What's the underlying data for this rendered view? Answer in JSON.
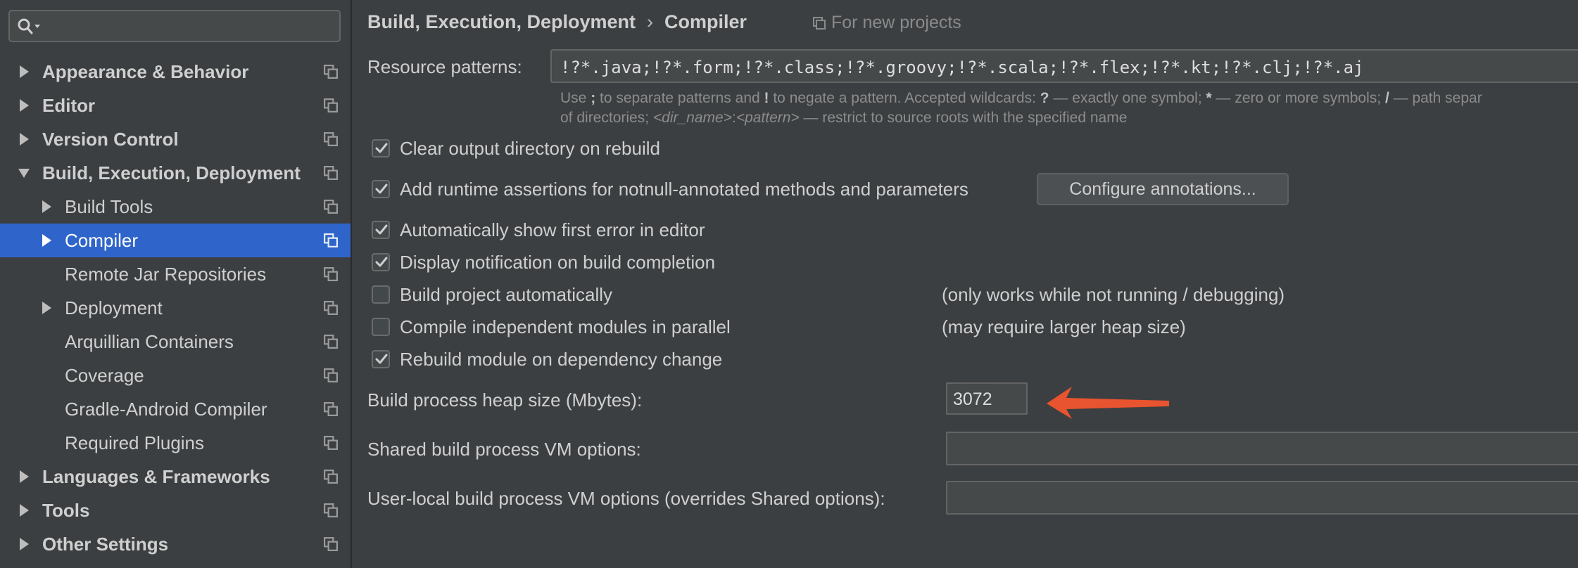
{
  "colors": {
    "selection": "#2f65ca",
    "background": "#3c3f41",
    "arrow_annotation": "#e8542f"
  },
  "sidebar": {
    "search": {
      "value": "",
      "icon": "search-icon"
    },
    "items": [
      {
        "label": "Appearance & Behavior",
        "expandable": true,
        "expanded": false,
        "level": 0
      },
      {
        "label": "Editor",
        "expandable": true,
        "expanded": false,
        "level": 0
      },
      {
        "label": "Version Control",
        "expandable": true,
        "expanded": false,
        "level": 0
      },
      {
        "label": "Build, Execution, Deployment",
        "expandable": true,
        "expanded": true,
        "level": 0
      },
      {
        "label": "Build Tools",
        "expandable": true,
        "expanded": false,
        "level": 1
      },
      {
        "label": "Compiler",
        "expandable": true,
        "expanded": false,
        "level": 1,
        "selected": true
      },
      {
        "label": "Remote Jar Repositories",
        "expandable": false,
        "level": 1
      },
      {
        "label": "Deployment",
        "expandable": true,
        "expanded": false,
        "level": 1
      },
      {
        "label": "Arquillian Containers",
        "expandable": false,
        "level": 1
      },
      {
        "label": "Coverage",
        "expandable": false,
        "level": 1
      },
      {
        "label": "Gradle-Android Compiler",
        "expandable": false,
        "level": 1
      },
      {
        "label": "Required Plugins",
        "expandable": false,
        "level": 1
      },
      {
        "label": "Languages & Frameworks",
        "expandable": true,
        "expanded": false,
        "level": 0
      },
      {
        "label": "Tools",
        "expandable": true,
        "expanded": false,
        "level": 0
      },
      {
        "label": "Other Settings",
        "expandable": true,
        "expanded": false,
        "level": 0
      }
    ]
  },
  "header": {
    "breadcrumb_parent": "Build, Execution, Deployment",
    "breadcrumb_separator": "›",
    "breadcrumb_current": "Compiler",
    "for_new_projects": "For new projects"
  },
  "resource_patterns": {
    "label": "Resource patterns:",
    "value": "!?*.java;!?*.form;!?*.class;!?*.groovy;!?*.scala;!?*.flex;!?*.kt;!?*.clj;!?*.aj",
    "hint_part1": "Use ",
    "hint_sym1": ";",
    "hint_part2": " to separate patterns and ",
    "hint_sym2": "!",
    "hint_part3": " to negate a pattern. Accepted wildcards: ",
    "hint_sym3": "?",
    "hint_part4": " — exactly one symbol; ",
    "hint_sym4": "*",
    "hint_part5": " — zero or more symbols; ",
    "hint_sym5": "/",
    "hint_part6": " — path separ",
    "hint_line2_part1": "of directories; ",
    "hint_line2_em1": "<dir_name>",
    "hint_line2_colon": ":",
    "hint_line2_em2": "<pattern>",
    "hint_line2_part2": " — restrict to source roots with the specified name"
  },
  "options": [
    {
      "label": "Clear output directory on rebuild",
      "checked": true
    },
    {
      "label": "Add runtime assertions for notnull-annotated methods and parameters",
      "checked": true
    },
    {
      "label": "Automatically show first error in editor",
      "checked": true
    },
    {
      "label": "Display notification on build completion",
      "checked": true
    },
    {
      "label": "Build project automatically",
      "checked": false,
      "note": "(only works while not running / debugging)"
    },
    {
      "label": "Compile independent modules in parallel",
      "checked": false,
      "note": "(may require larger heap size)"
    },
    {
      "label": "Rebuild module on dependency change",
      "checked": true
    }
  ],
  "configure_annotations_label": "Configure annotations...",
  "heap_size": {
    "label": "Build process heap size (Mbytes):",
    "value": "3072"
  },
  "shared_vm": {
    "label": "Shared build process VM options:",
    "value": ""
  },
  "user_local_vm": {
    "label": "User-local build process VM options (overrides Shared options):",
    "value": ""
  }
}
